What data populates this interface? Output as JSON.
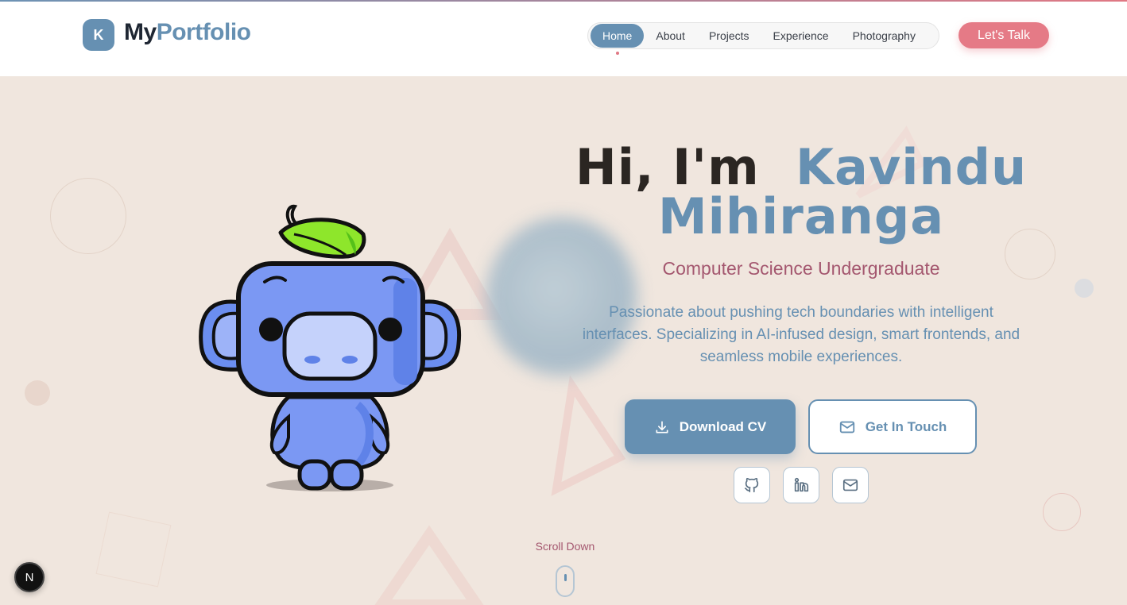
{
  "brand": {
    "badge_letter": "K",
    "name_part1": "My",
    "name_part2": "Portfolio"
  },
  "nav": {
    "items": [
      {
        "label": "Home",
        "active": true
      },
      {
        "label": "About",
        "active": false
      },
      {
        "label": "Projects",
        "active": false
      },
      {
        "label": "Experience",
        "active": false
      },
      {
        "label": "Photography",
        "active": false
      }
    ],
    "cta_label": "Let's Talk"
  },
  "hero": {
    "greeting": "Hi, I'm",
    "first_name": "Kavindu",
    "last_name": "Mihiranga",
    "subtitle": "Computer Science Undergraduate",
    "description": "Passionate about pushing tech boundaries with intelligent interfaces. Specializing in AI-infused design, smart frontends, and seamless mobile experiences.",
    "download_cv_label": "Download CV",
    "get_in_touch_label": "Get In Touch",
    "social_icons": [
      "github-icon",
      "linkedin-icon",
      "mail-icon"
    ],
    "scroll_label": "Scroll Down"
  },
  "dev_badge": {
    "letter": "N"
  },
  "colors": {
    "accent_blue": "#6690b2",
    "accent_pink": "#e57a86",
    "subtitle_mauve": "#a4576f",
    "background": "#f0e6de"
  }
}
